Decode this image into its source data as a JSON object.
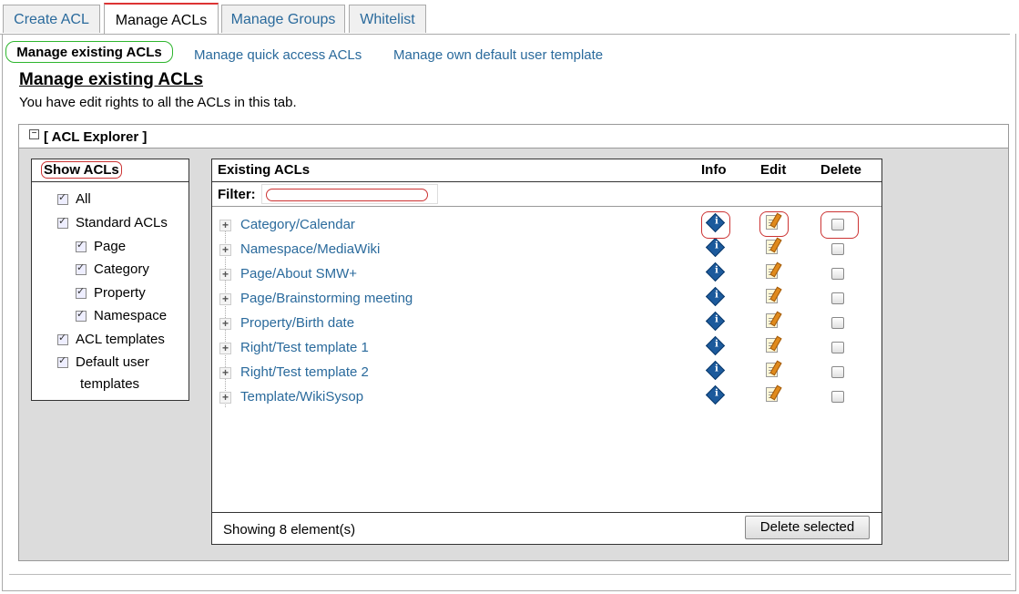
{
  "tabs": [
    {
      "label": "Create ACL",
      "active": false
    },
    {
      "label": "Manage ACLs",
      "active": true
    },
    {
      "label": "Manage Groups",
      "active": false
    },
    {
      "label": "Whitelist",
      "active": false
    }
  ],
  "subtabs": {
    "active": "Manage existing ACLs",
    "quick": "Manage quick access ACLs",
    "template": "Manage own default user template"
  },
  "page": {
    "title": "Manage existing ACLs",
    "description": "You have edit rights to all the ACLs in this tab."
  },
  "explorer": {
    "title": "[ ACL Explorer ]",
    "collapse_glyph": "−"
  },
  "show_acls": {
    "title": "Show ACLs",
    "items": [
      {
        "label": "All",
        "checked": true
      },
      {
        "label": "Standard ACLs",
        "checked": true
      },
      {
        "label": "Page",
        "checked": true
      },
      {
        "label": "Category",
        "checked": true
      },
      {
        "label": "Property",
        "checked": true
      },
      {
        "label": "Namespace",
        "checked": true
      },
      {
        "label": "ACL templates",
        "checked": true
      },
      {
        "label": "Default user",
        "checked": true
      },
      {
        "label": "templates",
        "checked": true
      }
    ]
  },
  "existing": {
    "col_name": "Existing ACLs",
    "col_info": "Info",
    "col_edit": "Edit",
    "col_delete": "Delete",
    "filter_label": "Filter:",
    "filter_value": "",
    "expand_glyph": "+",
    "info_glyph": "i",
    "rows": [
      "Category/Calendar",
      "Namespace/MediaWiki",
      "Page/About SMW+",
      "Page/Brainstorming meeting",
      "Property/Birth date",
      "Right/Test template 1",
      "Right/Test template 2",
      "Template/WikiSysop"
    ],
    "status": "Showing 8 element(s)",
    "delete_button": "Delete selected"
  },
  "colors": {
    "link": "#2a6a9c",
    "highlight_red": "#cc3333",
    "highlight_green": "#2db52d",
    "panel_bg": "#dcdcdc"
  },
  "icons": {
    "info": "info-icon",
    "edit": "edit-icon",
    "expand": "plus-icon",
    "collapse": "minus-icon"
  }
}
